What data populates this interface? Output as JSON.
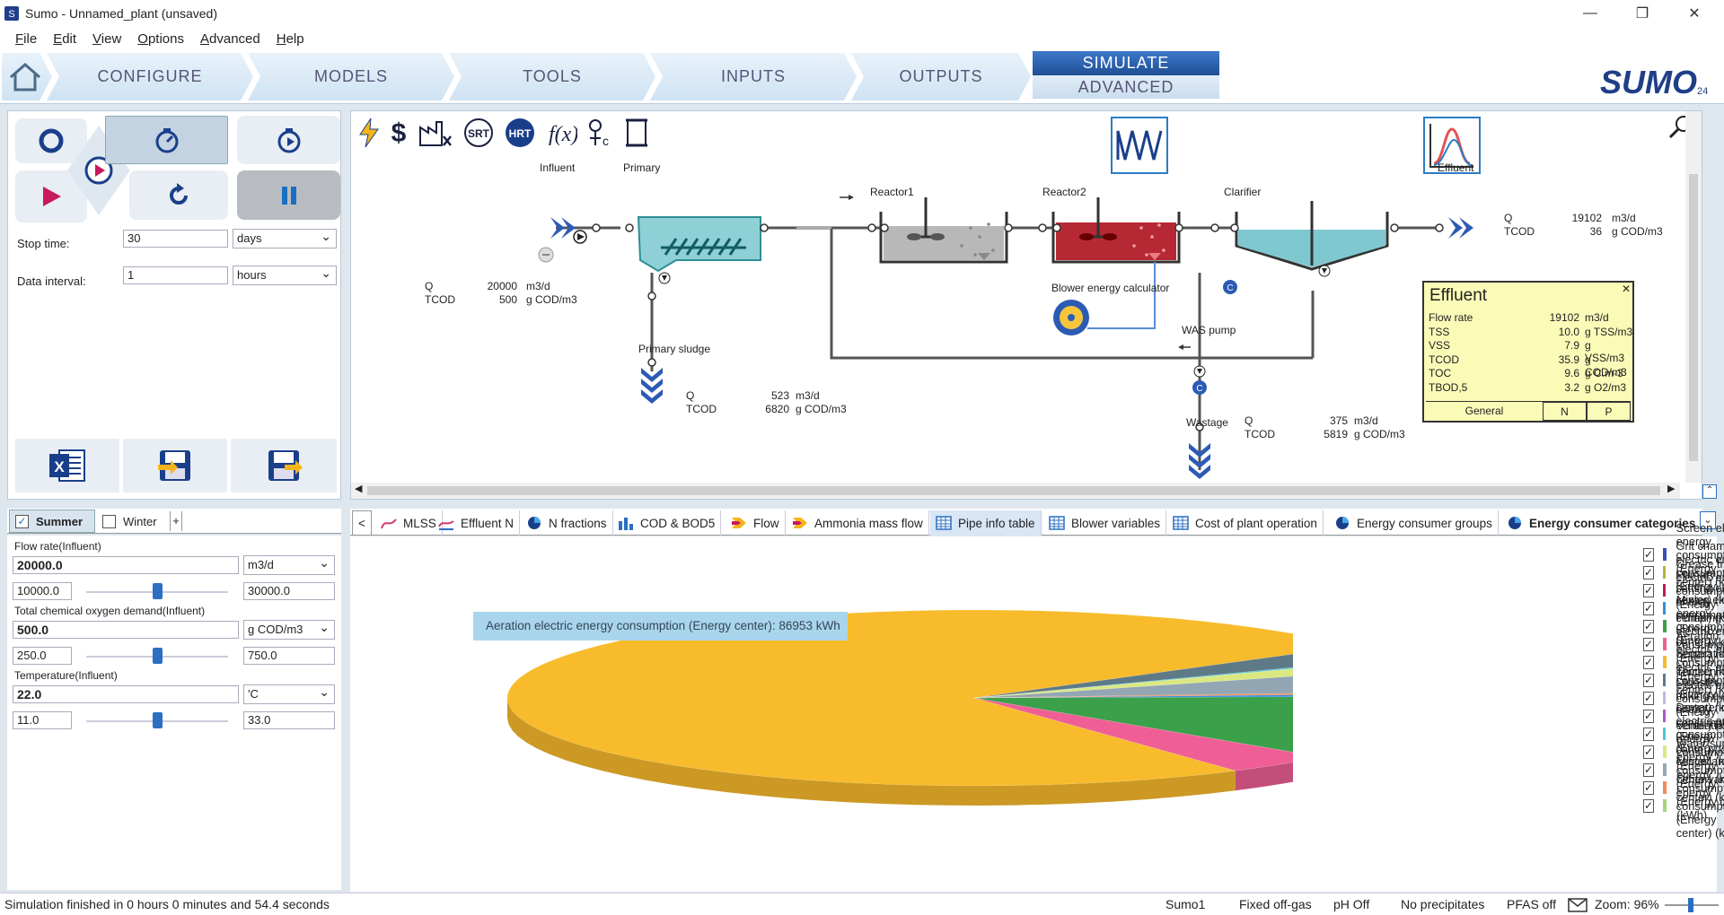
{
  "window": {
    "title": "Sumo - Unnamed_plant (unsaved)"
  },
  "menu": [
    "File",
    "Edit",
    "View",
    "Options",
    "Advanced",
    "Help"
  ],
  "ribbon": {
    "tabs": [
      "CONFIGURE",
      "MODELS",
      "TOOLS",
      "INPUTS",
      "OUTPUTS"
    ],
    "simulate": "SIMULATE",
    "advanced": "ADVANCED",
    "logo": "SUMO",
    "logo_version": "24"
  },
  "sim": {
    "stop_time_label": "Stop time:",
    "stop_time_value": "30",
    "stop_time_unit": "days",
    "data_interval_label": "Data interval:",
    "data_interval_value": "1",
    "data_interval_unit": "hours"
  },
  "scenarios": {
    "summer": "Summer",
    "winter": "Winter",
    "add": "+"
  },
  "params": [
    {
      "label": "Flow rate(Influent)",
      "value": "20000.0",
      "unit": "m3/d",
      "min": "10000.0",
      "max": "30000.0",
      "level": 0.5
    },
    {
      "label": "Total chemical oxygen demand(Influent)",
      "value": "500.0",
      "unit": "g COD/m3",
      "min": "250.0",
      "max": "750.0",
      "level": 0.5
    },
    {
      "label": "Temperature(Influent)",
      "value": "22.0",
      "unit": "'C",
      "min": "11.0",
      "max": "33.0",
      "level": 0.5
    }
  ],
  "flowsheet": {
    "labels": {
      "influent": "Influent",
      "primary": "Primary",
      "reactor1": "Reactor1",
      "reactor2": "Reactor2",
      "clarifier": "Clarifier",
      "effluent": "Effluent",
      "primary_sludge": "Primary sludge",
      "blower": "Blower energy calculator",
      "was_pump": "WAS pump",
      "wastage": "Wastage"
    },
    "influent_q": {
      "q_label": "Q",
      "q": "20000",
      "q_unit": "m3/d",
      "c_label": "TCOD",
      "c": "500",
      "c_unit": "g COD/m3"
    },
    "effluent_q": {
      "q_label": "Q",
      "q": "19102",
      "q_unit": "m3/d",
      "c_label": "TCOD",
      "c": "36",
      "c_unit": "g COD/m3"
    },
    "sludge_q": {
      "q_label": "Q",
      "q": "523",
      "q_unit": "m3/d",
      "c_label": "TCOD",
      "c": "6820",
      "c_unit": "g COD/m3"
    },
    "wastage_q": {
      "q_label": "Q",
      "q": "375",
      "q_unit": "m3/d",
      "c_label": "TCOD",
      "c": "5819",
      "c_unit": "g COD/m3"
    },
    "effluent_box": {
      "title": "Effluent",
      "rows": [
        {
          "name": "Flow rate",
          "value": "19102",
          "unit": "m3/d"
        },
        {
          "name": "TSS",
          "value": "10.0",
          "unit": "g TSS/m3"
        },
        {
          "name": "VSS",
          "value": "7.9",
          "unit": "g VSS/m3"
        },
        {
          "name": "TCOD",
          "value": "35.9",
          "unit": "g COD/m3"
        },
        {
          "name": "TOC",
          "value": "9.6",
          "unit": "g C.m-3"
        },
        {
          "name": "TBOD,5",
          "value": "3.2",
          "unit": "g O2/m3"
        }
      ],
      "tabs": [
        "General",
        "N",
        "P"
      ]
    }
  },
  "output_tabs": [
    "<",
    "MLSS",
    "Effluent N",
    "N fractions",
    "COD & BOD5",
    "Flow",
    "Ammonia mass flow",
    "Pipe info table",
    "Blower variables",
    "Cost of plant operation",
    "Energy consumer groups",
    "Energy consumer categories"
  ],
  "tooltip": "Aeration electric energy consumption (Energy center): 86953 kWh",
  "chart_data": {
    "type": "pie",
    "series": [
      {
        "name": "Screen electric energy consumption (Energy center) (kWh)",
        "color": "#3a50b8",
        "value": 0
      },
      {
        "name": "Grit chamber electric energy consumption (Energy center) (kWh)",
        "color": "#b5b536",
        "value": 0
      },
      {
        "name": "Grease trap electric energy consumption (Energy center) (kWh)",
        "color": "#c0185c",
        "value": 0
      },
      {
        "name": "Primary settling electric energy consumption (Energy center) (kWh)",
        "color": "#2f8fe0",
        "value": 600
      },
      {
        "name": "Mixing electric energy consumption (Energy center) (kWh)",
        "color": "#3aa04a",
        "value": 14000
      },
      {
        "name": "Pumping electric energy consumption (Energy center) (kWh)",
        "color": "#ef5f95",
        "value": 4500
      },
      {
        "name": "Aeration electric energy consumption (Energy center) (kWh)",
        "color": "#f8bb2c",
        "value": 86953
      },
      {
        "name": "Separation electric energy consumption (Energy center) (kWh)",
        "color": "#5f7a87",
        "value": 3000
      },
      {
        "name": "Thickening electric energy consumption (Energy center) (kWh)",
        "color": "#c7b6e3",
        "value": 0
      },
      {
        "name": "Digester mixing electric energy consumption (Energy center) (kWh)",
        "color": "#b355c9",
        "value": 0
      },
      {
        "name": "Dewatering electric energy consumption (Energy center) (kWh)",
        "color": "#4ac6e2",
        "value": 300
      },
      {
        "name": "Ventilation energy consumption (Energy center) (kWh)",
        "color": "#dbe882",
        "value": 2000
      },
      {
        "name": "Water supply energy consumption (Energy center) (kWh)",
        "color": "#93a6b3",
        "value": 5000
      },
      {
        "name": "Miscellaneous energy consumption (Energy center) (kWh)",
        "color": "#f58a5a",
        "value": 500
      },
      {
        "name": "Other variable energy consumption (Energy center) (kWh)",
        "color": "#a5d47c",
        "value": 0
      }
    ]
  },
  "status": {
    "message": "Simulation finished in 0 hours 0 minutes and 54.4 seconds",
    "items": [
      "Sumo1",
      "Fixed off-gas",
      "pH Off",
      "No precipitates",
      "PFAS off"
    ],
    "zoom": "Zoom: 96%"
  }
}
